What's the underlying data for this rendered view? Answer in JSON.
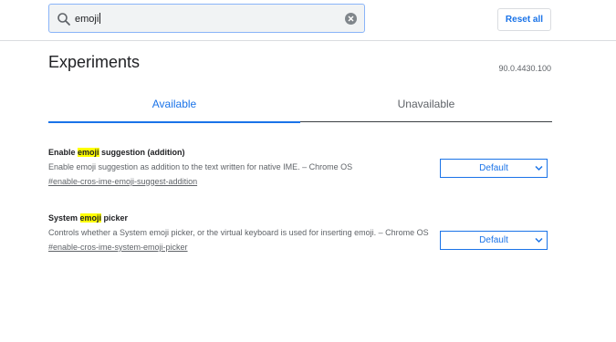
{
  "search": {
    "query": "emoji",
    "clear_icon": "clear-icon",
    "search_icon": "search-icon"
  },
  "header": {
    "reset_label": "Reset all"
  },
  "page": {
    "title": "Experiments",
    "version": "90.0.4430.100"
  },
  "tabs": [
    {
      "label": "Available",
      "active": true
    },
    {
      "label": "Unavailable",
      "active": false
    }
  ],
  "experiments": [
    {
      "name_pre": "Enable ",
      "name_hl": "emoji",
      "name_post": " suggestion (addition)",
      "description": "Enable emoji suggestion as addition to the text written for native IME. – Chrome OS",
      "link": "#enable-cros-ime-emoji-suggest-addition",
      "value": "Default"
    },
    {
      "name_pre": "System ",
      "name_hl": "emoji",
      "name_post": " picker",
      "description": "Controls whether a System emoji picker, or the virtual keyboard is used for inserting emoji. – Chrome OS",
      "link": "#enable-cros-ime-system-emoji-picker",
      "value": "Default"
    }
  ],
  "colors": {
    "accent": "#1a73e8",
    "highlight": "#ffff00"
  }
}
